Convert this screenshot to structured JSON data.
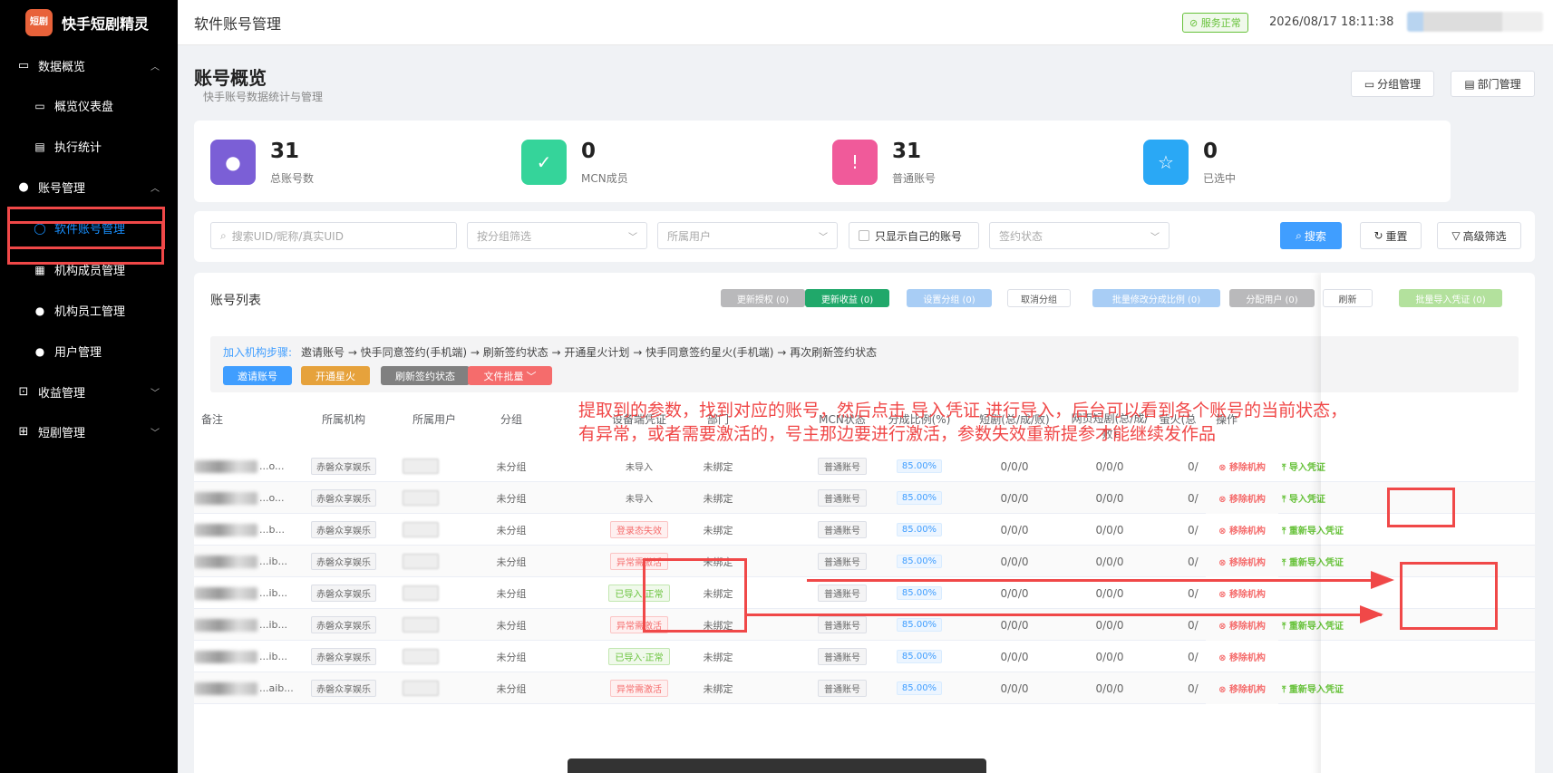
{
  "app": {
    "logo_text": "短剧",
    "name": "快手短剧精灵"
  },
  "sidebar": {
    "groups": [
      {
        "label": "数据概览",
        "icon": "monitor-icon",
        "expanded": true,
        "items": [
          {
            "label": "概览仪表盘",
            "icon": "monitor-icon"
          },
          {
            "label": "执行统计",
            "icon": "chart-icon"
          }
        ]
      },
      {
        "label": "账号管理",
        "icon": "user-icon",
        "expanded": true,
        "items": [
          {
            "label": "软件账号管理",
            "icon": "user-outline-icon",
            "active": true
          },
          {
            "label": "机构成员管理",
            "icon": "building-icon"
          },
          {
            "label": "机构员工管理",
            "icon": "user-icon"
          },
          {
            "label": "用户管理",
            "icon": "user-icon"
          }
        ]
      },
      {
        "label": "收益管理",
        "icon": "money-icon",
        "expanded": false,
        "items": []
      },
      {
        "label": "短剧管理",
        "icon": "grid-icon",
        "expanded": false,
        "items": []
      }
    ]
  },
  "topbar": {
    "page_title": "软件账号管理",
    "status": "服务正常",
    "datetime": "2026/08/17 18:11:38"
  },
  "header": {
    "title": "账号概览",
    "subtitle": "快手账号数据统计与管理",
    "group_btn": "分组管理",
    "dept_btn": "部门管理"
  },
  "stats": [
    {
      "value": "31",
      "label": "总账号数",
      "color": "#7b5fd6",
      "icon": "user-icon"
    },
    {
      "value": "0",
      "label": "MCN成员",
      "color": "#35d49a",
      "icon": "check-icon"
    },
    {
      "value": "31",
      "label": "普通账号",
      "color": "#f05a9a",
      "icon": "alert-icon"
    },
    {
      "value": "0",
      "label": "已选中",
      "color": "#2aa8f5",
      "icon": "star-icon"
    }
  ],
  "filters": {
    "search_placeholder": "搜索UID/昵称/真实UID",
    "group_placeholder": "按分组筛选",
    "user_placeholder": "所属用户",
    "only_mine": "只显示自己的账号",
    "sign_placeholder": "签约状态",
    "search_btn": "搜索",
    "reset_btn": "重置",
    "advanced_btn": "高级筛选"
  },
  "list": {
    "title": "账号列表",
    "toolbar": [
      {
        "label": "更新授权 (0)",
        "color": "#b9b9bb"
      },
      {
        "label": "更新收益 (0)",
        "color": "#20a86a"
      },
      {
        "label": "设置分组 (0)",
        "color": "#a8cdf5"
      },
      {
        "label": "取消分组",
        "color": "#ffffff"
      },
      {
        "label": "批量修改分成比例 (0)",
        "color": "#a8cdf5"
      },
      {
        "label": "分配用户 (0)",
        "color": "#b9b9bb"
      },
      {
        "label": "刷新",
        "color": "#ffffff"
      },
      {
        "label": "批量导入凭证 (0)",
        "color": "#b3e19d"
      }
    ],
    "steps_label": "加入机构步骤:",
    "steps_text": "邀请账号 → 快手同意签约(手机端) → 刷新签约状态 → 开通星火计划 → 快手同意签约星火(手机端) → 再次刷新签约状态",
    "step_buttons": [
      {
        "label": "邀请账号",
        "color": "#409eff"
      },
      {
        "label": "开通星火",
        "color": "#e6a23c"
      },
      {
        "label": "刷新签约状态",
        "color": "#808080"
      },
      {
        "label": "文件批量",
        "color": "#f56c6c"
      }
    ],
    "columns": [
      "备注",
      "所属机构",
      "所属用户",
      "分组",
      "设备端凭证",
      "部门",
      "MCN状态",
      "分成比例(%)",
      "短剧(总/成/败)",
      "网页短剧(总/成/败)",
      "萤火(总",
      "操作"
    ],
    "rows": [
      {
        "note": "...o...",
        "org": "赤磐众享娱乐",
        "group": "未分组",
        "cred": "未导入",
        "cred_type": "none",
        "dept": "未绑定",
        "mcn": "普通账号",
        "ratio": "85.00%",
        "drama": "0/0/0",
        "web": "0/0/0",
        "fire": "0/",
        "remove": "移除机构",
        "import": "导入凭证"
      },
      {
        "note": "...o...",
        "org": "赤磐众享娱乐",
        "group": "未分组",
        "cred": "未导入",
        "cred_type": "none",
        "dept": "未绑定",
        "mcn": "普通账号",
        "ratio": "85.00%",
        "drama": "0/0/0",
        "web": "0/0/0",
        "fire": "0/",
        "remove": "移除机构",
        "import": "导入凭证"
      },
      {
        "note": "...b...",
        "org": "赤磐众享娱乐",
        "group": "未分组",
        "cred": "登录态失效",
        "cred_type": "bad",
        "dept": "未绑定",
        "mcn": "普通账号",
        "ratio": "85.00%",
        "drama": "0/0/0",
        "web": "0/0/0",
        "fire": "0/",
        "remove": "移除机构",
        "import": "重新导入凭证"
      },
      {
        "note": "...ib...",
        "org": "赤磐众享娱乐",
        "group": "未分组",
        "cred": "异常需激活",
        "cred_type": "bad",
        "dept": "未绑定",
        "mcn": "普通账号",
        "ratio": "85.00%",
        "drama": "0/0/0",
        "web": "0/0/0",
        "fire": "0/",
        "remove": "移除机构",
        "import": "重新导入凭证"
      },
      {
        "note": "...ib...",
        "org": "赤磐众享娱乐",
        "group": "未分组",
        "cred": "已导入·正常",
        "cred_type": "ok",
        "dept": "未绑定",
        "mcn": "普通账号",
        "ratio": "85.00%",
        "drama": "0/0/0",
        "web": "0/0/0",
        "fire": "0/",
        "remove": "移除机构",
        "import": ""
      },
      {
        "note": "...ib...",
        "org": "赤磐众享娱乐",
        "group": "未分组",
        "cred": "异常需激活",
        "cred_type": "bad",
        "dept": "未绑定",
        "mcn": "普通账号",
        "ratio": "85.00%",
        "drama": "0/0/0",
        "web": "0/0/0",
        "fire": "0/",
        "remove": "移除机构",
        "import": "重新导入凭证"
      },
      {
        "note": "...ib...",
        "org": "赤磐众享娱乐",
        "group": "未分组",
        "cred": "已导入·正常",
        "cred_type": "ok",
        "dept": "未绑定",
        "mcn": "普通账号",
        "ratio": "85.00%",
        "drama": "0/0/0",
        "web": "0/0/0",
        "fire": "0/",
        "remove": "移除机构",
        "import": ""
      },
      {
        "note": "...aib...",
        "org": "赤磐众享娱乐",
        "group": "未分组",
        "cred": "异常需激活",
        "cred_type": "bad",
        "dept": "未绑定",
        "mcn": "普通账号",
        "ratio": "85.00%",
        "drama": "0/0/0",
        "web": "0/0/0",
        "fire": "0/",
        "remove": "移除机构",
        "import": "重新导入凭证"
      }
    ]
  },
  "annotation": {
    "text": "提取到的参数，找到对应的账号，然后点击 导入凭证 进行导入，后台可以看到各个账号的当前状态，有异常，或者需要激活的，号主那边要进行激活，参数失效重新提参才能继续发作品",
    "color": "#f04848"
  }
}
